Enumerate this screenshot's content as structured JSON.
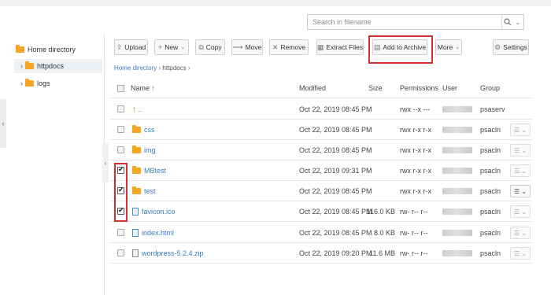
{
  "search": {
    "placeholder": "Search in filename"
  },
  "sidebar": {
    "items": [
      {
        "label": "Home directory"
      },
      {
        "label": "httpdocs"
      },
      {
        "label": "logs"
      }
    ]
  },
  "toolbar": {
    "upload": "Upload",
    "new": "New",
    "copy": "Copy",
    "move": "Move",
    "remove": "Remove",
    "extract": "Extract Files",
    "archive": "Add to Archive",
    "more": "More",
    "settings": "Settings"
  },
  "breadcrumb": {
    "home": "Home directory",
    "current": "httpdocs"
  },
  "table": {
    "headers": {
      "name": "Name",
      "modified": "Modified",
      "size": "Size",
      "permissions": "Permissions",
      "user": "User",
      "group": "Group"
    },
    "rows": [
      {
        "name": "..",
        "modified": "Oct 22, 2019 08:45 PM",
        "size": "",
        "permissions": "rwx --x ---",
        "group": "psaserv",
        "checked": false
      },
      {
        "name": "css",
        "modified": "Oct 22, 2019 08:45 PM",
        "size": "",
        "permissions": "rwx r-x r-x",
        "group": "psacln",
        "checked": false
      },
      {
        "name": "img",
        "modified": "Oct 22, 2019 08:45 PM",
        "size": "",
        "permissions": "rwx r-x r-x",
        "group": "psacln",
        "checked": false
      },
      {
        "name": "MBtest",
        "modified": "Oct 22, 2019 09:31 PM",
        "size": "",
        "permissions": "rwx r-x r-x",
        "group": "psacln",
        "checked": true
      },
      {
        "name": "test",
        "modified": "Oct 22, 2019 08:45 PM",
        "size": "",
        "permissions": "rwx r-x r-x",
        "group": "psacln",
        "checked": true
      },
      {
        "name": "favicon.ico",
        "modified": "Oct 22, 2019 08:45 PM",
        "size": "116.0 KB",
        "permissions": "rw- r-- r--",
        "group": "psacln",
        "checked": true
      },
      {
        "name": "index.html",
        "modified": "Oct 22, 2019 08:45 PM",
        "size": "8.0 KB",
        "permissions": "rw- r-- r--",
        "group": "psacln",
        "checked": false
      },
      {
        "name": "wordpress-5.2.4.zip",
        "modified": "Oct 22, 2019 09:20 PM",
        "size": "11.6 MB",
        "permissions": "rw- r-- r--",
        "group": "psacln",
        "checked": false
      }
    ]
  },
  "colors": {
    "accent": "#3a7bbf",
    "folder": "#f5a623",
    "highlight": "#d32f2f"
  }
}
